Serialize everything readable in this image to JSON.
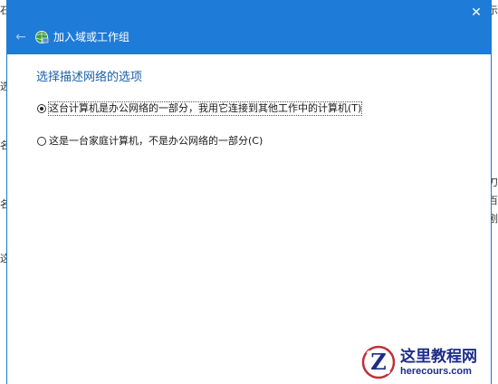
{
  "background": {
    "left_fragments": [
      "石",
      "选",
      "名",
      "名",
      "这"
    ],
    "right_fragments": [
      "示",
      "刀",
      "百",
      "剧"
    ]
  },
  "dialog": {
    "close_glyph": "✕",
    "back_glyph": "←",
    "title": "加入域或工作组",
    "heading": "选择描述网络的选项",
    "options": [
      {
        "label": "这台计算机是办公网络的一部分，我用它连接到其他工作中的计算机(T)",
        "selected": true
      },
      {
        "label": "这是一台家庭计算机，不是办公网络的一部分(C)",
        "selected": false
      }
    ]
  },
  "watermark": {
    "name": "这里教程网",
    "url": "herecours.com"
  },
  "colors": {
    "titlebar": "#1e7bd8",
    "heading": "#1a5ea8",
    "watermark": "#1d2c88"
  }
}
